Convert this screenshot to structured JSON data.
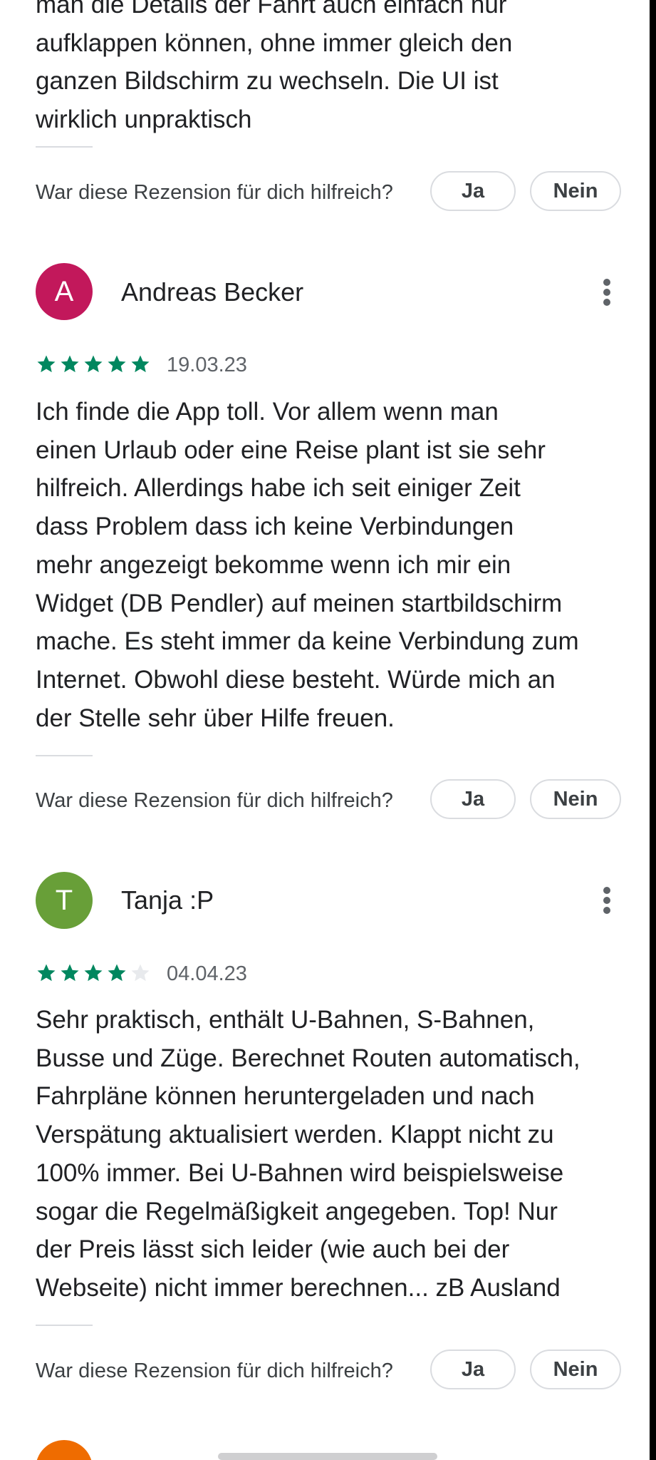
{
  "top_review": {
    "text_lines": [
      "man die Details der Fahrt auch einfach nur",
      "aufklappen können, ohne immer gleich den",
      "ganzen Bildschirm zu wechseln. Die UI ist",
      "wirklich unpraktisch"
    ],
    "helpful_question": "War diese Rezension für dich hilfreich?",
    "yes_label": "Ja",
    "no_label": "Nein"
  },
  "reviews": [
    {
      "author": "Andreas Becker",
      "initial": "A",
      "avatar_color": "#c2185b",
      "rating": 5,
      "date": "19.03.23",
      "text_lines": [
        "Ich finde die App toll. Vor allem wenn man",
        "einen Urlaub oder eine Reise plant ist sie sehr",
        "hilfreich. Allerdings habe ich seit einiger Zeit",
        "dass Problem dass ich keine Verbindungen",
        "mehr angezeigt bekomme wenn ich mir ein",
        "Widget (DB Pendler) auf meinen startbildschirm",
        "mache. Es steht immer da keine Verbindung zum",
        "Internet. Obwohl diese besteht. Würde mich an",
        "der Stelle sehr über Hilfe freuen."
      ],
      "helpful_question": "War diese Rezension für dich hilfreich?",
      "yes_label": "Ja",
      "no_label": "Nein",
      "menu_icon": "more-vert-icon"
    },
    {
      "author": "Tanja :P",
      "initial": "T",
      "avatar_color": "#689f38",
      "rating": 4,
      "date": "04.04.23",
      "text_lines": [
        "Sehr praktisch, enthält U-Bahnen, S-Bahnen,",
        "Busse und Züge. Berechnet Routen automatisch,",
        "Fahrpläne können heruntergeladen und nach",
        "Verspätung aktualisiert werden. Klappt nicht zu",
        "100% immer. Bei U-Bahnen wird beispielsweise",
        "sogar die Regelmäßigkeit angegeben. Top! Nur",
        "der Preis lässt sich leider (wie auch bei der",
        "Webseite) nicht immer berechnen... zB Ausland"
      ],
      "helpful_question": "War diese Rezension für dich hilfreich?",
      "yes_label": "Ja",
      "no_label": "Nein",
      "menu_icon": "more-vert-icon"
    }
  ],
  "next_review": {
    "avatar_color": "#ef6c00"
  },
  "colors": {
    "star_filled": "#01875f",
    "star_empty": "#e8eaed",
    "text": "#202124",
    "secondary_text": "#5f6368"
  }
}
